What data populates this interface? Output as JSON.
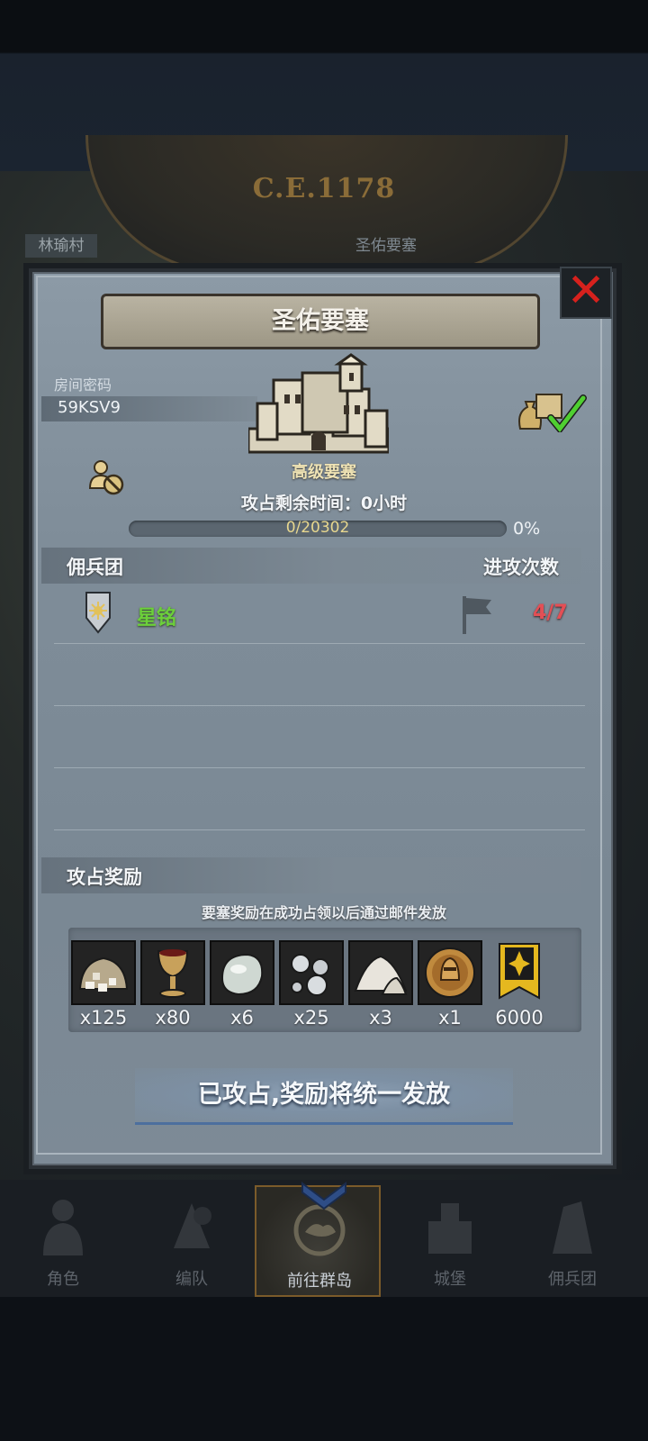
{
  "background": {
    "era": "C.E.1178",
    "map_label_left": "林瑜村",
    "map_label_right": "圣佑要塞"
  },
  "dialog": {
    "title": "圣佑要塞",
    "room_label": "房间密码",
    "room_code": "59KSV9",
    "fortress_type": "高级要塞",
    "occupy_time": "攻占剩余时间：0小时",
    "progress_text": "0/20302",
    "progress_pct": "0%",
    "progress_value": 0,
    "section_mercenary": "佣兵团",
    "section_attack_count": "进攻次数",
    "guilds": [
      {
        "name": "星铭",
        "attempts": "4/7",
        "name_color": "#6cd03a"
      }
    ],
    "section_reward": "攻占奖励",
    "reward_note": "要塞奖励在成功占领以后通过邮件发放",
    "rewards": [
      {
        "icon": "ore-pile-icon",
        "count": "x125"
      },
      {
        "icon": "goblet-icon",
        "count": "x80"
      },
      {
        "icon": "moonstone-icon",
        "count": "x6"
      },
      {
        "icon": "silver-beads-icon",
        "count": "x25"
      },
      {
        "icon": "powder-pile-icon",
        "count": "x3"
      },
      {
        "icon": "knight-medal-icon",
        "count": "x1"
      },
      {
        "icon": "guild-banner-icon",
        "count": "6000"
      }
    ],
    "status_button": "已攻占,奖励将统一发放"
  },
  "nav": {
    "items": [
      {
        "label": "角色",
        "icon": "character-icon"
      },
      {
        "label": "编队",
        "icon": "formation-icon"
      },
      {
        "label": "前往群岛",
        "icon": "islands-icon"
      },
      {
        "label": "城堡",
        "icon": "castle-icon"
      },
      {
        "label": "佣兵团",
        "icon": "mercenary-icon"
      }
    ]
  },
  "colors": {
    "accent_red": "#e34f55",
    "guild_green": "#6cd03a",
    "close_red": "#d6211d"
  }
}
